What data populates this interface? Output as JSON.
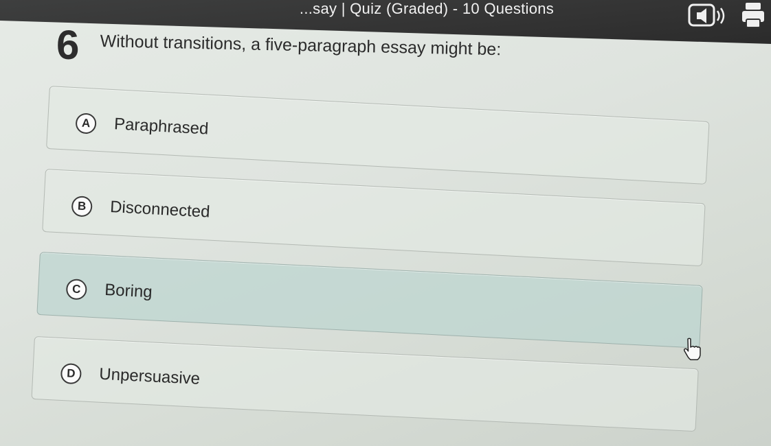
{
  "header": {
    "title": "...say | Quiz (Graded) - 10 Questions",
    "icons": {
      "audio": "speaker-icon",
      "print": "printer-icon"
    }
  },
  "question": {
    "number": "6",
    "text": "Without transitions, a five-paragraph essay might be:"
  },
  "answers": [
    {
      "letter": "A",
      "label": "Paraphrased",
      "selected": false
    },
    {
      "letter": "B",
      "label": "Disconnected",
      "selected": false
    },
    {
      "letter": "C",
      "label": "Boring",
      "selected": true
    },
    {
      "letter": "D",
      "label": "Unpersuasive",
      "selected": false
    }
  ],
  "colors": {
    "header_bg": "#333333",
    "selected_bg": "#bed6d0",
    "answer_bg": "#e4e9e4"
  }
}
